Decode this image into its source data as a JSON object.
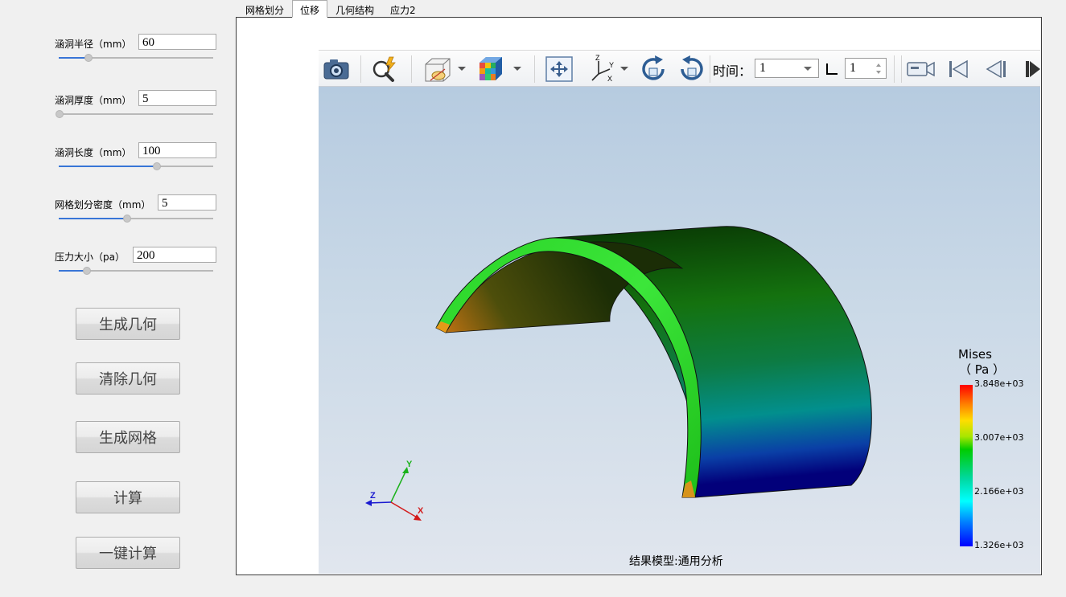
{
  "tabs": [
    {
      "label": "网格划分",
      "active": false
    },
    {
      "label": "位移",
      "active": true
    },
    {
      "label": "几何结构",
      "active": false
    },
    {
      "label": "应力2",
      "active": false
    }
  ],
  "params": {
    "radius": {
      "label": "涵洞半径（mm）",
      "value": "60",
      "slider_fraction": 0.19
    },
    "thickness": {
      "label": "涵洞厚度（mm）",
      "value": "5",
      "slider_fraction": 0.0
    },
    "length": {
      "label": "涵洞长度（mm）",
      "value": "100",
      "slider_fraction": 0.64
    },
    "mesh_density": {
      "label": "网格划分密度（mm）",
      "value": "5",
      "slider_fraction": 0.44
    },
    "pressure": {
      "label": "压力大小（pa）",
      "value": "200",
      "slider_fraction": 0.18
    }
  },
  "buttons": {
    "gen_geometry": "生成几何",
    "clear_geometry": "清除几何",
    "gen_mesh": "生成网格",
    "compute": "计算",
    "one_click": "一键计算"
  },
  "toolbar": {
    "icons": [
      "camera-icon",
      "zoom-fit-icon",
      "display-mode-icon",
      "color-cube-icon",
      "pan-view-icon",
      "axes-icon",
      "rotate-cw-icon",
      "rotate-ccw-icon",
      "video-camera-icon",
      "first-frame-icon",
      "prev-frame-icon",
      "next-frame-icon"
    ],
    "time_label": "时间：",
    "time_value": "1",
    "frame_value": "1"
  },
  "viewport": {
    "legend_title_line1": "Mises",
    "legend_title_line2": "（ Pa ）",
    "legend_ticks": [
      "3.848e+03",
      "3.007e+03",
      "2.166e+03",
      "1.326e+03"
    ],
    "caption": "结果模型:通用分析",
    "axis_labels": {
      "x": "X",
      "y": "Y",
      "z": "Z"
    }
  },
  "colors": {
    "accent": "#3875d7",
    "background": "#f0f0f0",
    "viewport_top": "#b6cbe0",
    "viewport_bottom": "#e1e6ee"
  }
}
